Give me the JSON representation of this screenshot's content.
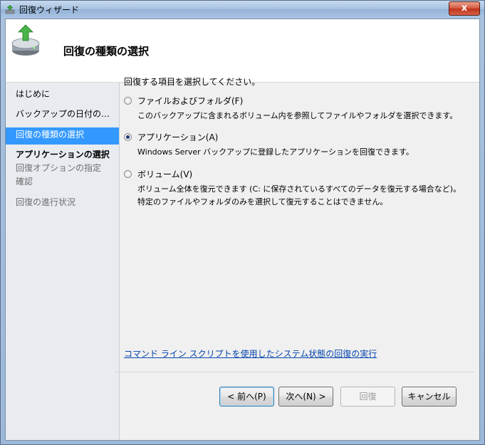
{
  "window": {
    "title": "回復ウィザード",
    "close_label": "x"
  },
  "header": {
    "title": "回復の種類の選択"
  },
  "nav": {
    "items": [
      {
        "label": "はじめに",
        "state": "normal"
      },
      {
        "label": "バックアップの日付の…",
        "state": "normal"
      },
      {
        "label": "回復の種類の選択",
        "state": "selected"
      },
      {
        "label": "アプリケーションの選択",
        "state": "bold"
      },
      {
        "label": "回復オプションの指定",
        "state": "sub"
      },
      {
        "label": "確認",
        "state": "sub"
      },
      {
        "label": "回復の進行状況",
        "state": "sub"
      }
    ]
  },
  "content": {
    "prompt": "回復する項目を選択してください。",
    "options": [
      {
        "label": "ファイルおよびフォルダ(F)",
        "description": "このバックアップに含まれるボリューム内を参照してファイルやフォルダを選択できます。",
        "checked": false
      },
      {
        "label": "アプリケーション(A)",
        "description": "Windows Server バックアップに登録したアプリケーションを回復できます。",
        "checked": true
      },
      {
        "label": "ボリューム(V)",
        "description": "ボリューム全体を復元できます (C: に保存されているすべてのデータを復元する場合など)。",
        "description2": "特定のファイルやフォルダのみを選択して復元することはできません。",
        "checked": false
      }
    ],
    "link": "コマンド ライン スクリプトを使用したシステム状態の回復の実行"
  },
  "buttons": {
    "back": "< 前へ(P)",
    "next": "次へ(N) >",
    "recover": "回復",
    "cancel": "キャンセル"
  }
}
